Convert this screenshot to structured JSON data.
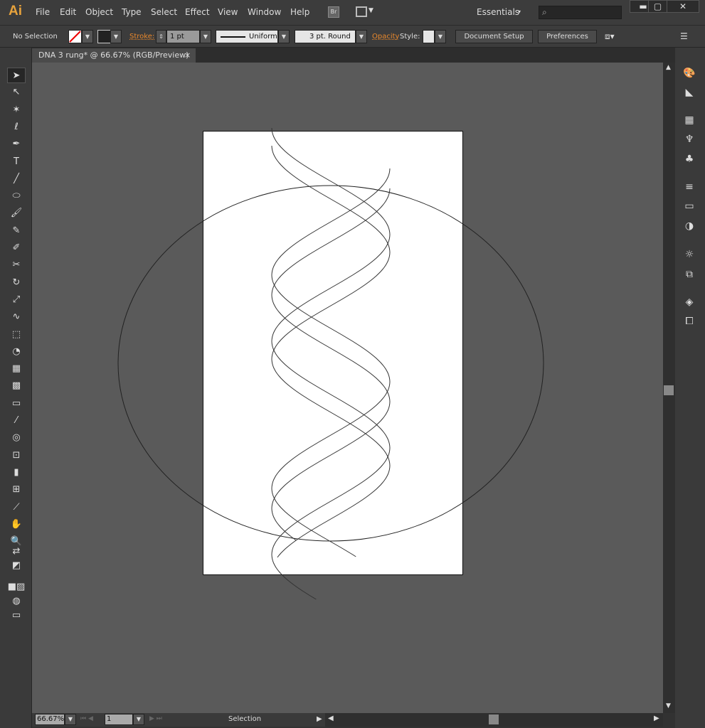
{
  "app": {
    "logo": "Ai",
    "menus": [
      "File",
      "Edit",
      "Object",
      "Type",
      "Select",
      "Effect",
      "View",
      "Window",
      "Help"
    ],
    "bridge": "Br",
    "workspace": "Essentials",
    "search_placeholder": ""
  },
  "window": {
    "minimize": "▬",
    "maximize": "▢",
    "close": "✕"
  },
  "control": {
    "selection": "No Selection",
    "stroke_label": "Stroke:",
    "stroke_weight": "1 pt",
    "profile": "Uniform",
    "brush": "3 pt. Round",
    "opacity_label": "Opacity",
    "style_label": "Style:",
    "doc_setup": "Document Setup",
    "preferences": "Preferences"
  },
  "document": {
    "tab_title": "DNA 3 rung* @ 66.67% (RGB/Preview)",
    "close": "×"
  },
  "tools": [
    {
      "name": "selection-tool",
      "glyph": "➤"
    },
    {
      "name": "direct-selection-tool",
      "glyph": "↖"
    },
    {
      "name": "magic-wand-tool",
      "glyph": "✶"
    },
    {
      "name": "lasso-tool",
      "glyph": "ℓ"
    },
    {
      "name": "pen-tool",
      "glyph": "✒"
    },
    {
      "name": "type-tool",
      "glyph": "T"
    },
    {
      "name": "line-tool",
      "glyph": "╱"
    },
    {
      "name": "ellipse-tool",
      "glyph": "⬭"
    },
    {
      "name": "paintbrush-tool",
      "glyph": "🖌"
    },
    {
      "name": "pencil-tool",
      "glyph": "✎"
    },
    {
      "name": "blob-brush-tool",
      "glyph": "✐"
    },
    {
      "name": "scissors-tool",
      "glyph": "✂"
    },
    {
      "name": "rotate-tool",
      "glyph": "↻"
    },
    {
      "name": "scale-tool",
      "glyph": "⤢"
    },
    {
      "name": "warp-tool",
      "glyph": "∿"
    },
    {
      "name": "free-transform-tool",
      "glyph": "⬚"
    },
    {
      "name": "shape-builder-tool",
      "glyph": "◔"
    },
    {
      "name": "perspective-grid-tool",
      "glyph": "▦"
    },
    {
      "name": "mesh-tool",
      "glyph": "▩"
    },
    {
      "name": "gradient-tool",
      "glyph": "▭"
    },
    {
      "name": "eyedropper-tool",
      "glyph": "⁄"
    },
    {
      "name": "blend-tool",
      "glyph": "◎"
    },
    {
      "name": "symbol-sprayer-tool",
      "glyph": "⊡"
    },
    {
      "name": "column-graph-tool",
      "glyph": "▮"
    },
    {
      "name": "artboard-tool",
      "glyph": "⊞"
    },
    {
      "name": "slice-tool",
      "glyph": "⟋"
    },
    {
      "name": "hand-tool",
      "glyph": "✋"
    },
    {
      "name": "zoom-tool",
      "glyph": "🔍"
    }
  ],
  "right_panels": [
    {
      "name": "color-panel",
      "glyph": "🎨"
    },
    {
      "name": "color-guide-panel",
      "glyph": "◣"
    },
    {
      "name": "swatches-panel",
      "glyph": "▦"
    },
    {
      "name": "brushes-panel",
      "glyph": "♆"
    },
    {
      "name": "symbols-panel",
      "glyph": "♣"
    },
    {
      "name": "stroke-panel",
      "glyph": "≡"
    },
    {
      "name": "gradient-panel",
      "glyph": "▭"
    },
    {
      "name": "transparency-panel",
      "glyph": "◑"
    },
    {
      "name": "appearance-panel",
      "glyph": "☼"
    },
    {
      "name": "graphic-styles-panel",
      "glyph": "⧉"
    },
    {
      "name": "layers-panel",
      "glyph": "◈"
    },
    {
      "name": "artboards-panel",
      "glyph": "⧠"
    }
  ],
  "status": {
    "zoom": "66.67%",
    "artboard": "1",
    "tool": "Selection"
  }
}
